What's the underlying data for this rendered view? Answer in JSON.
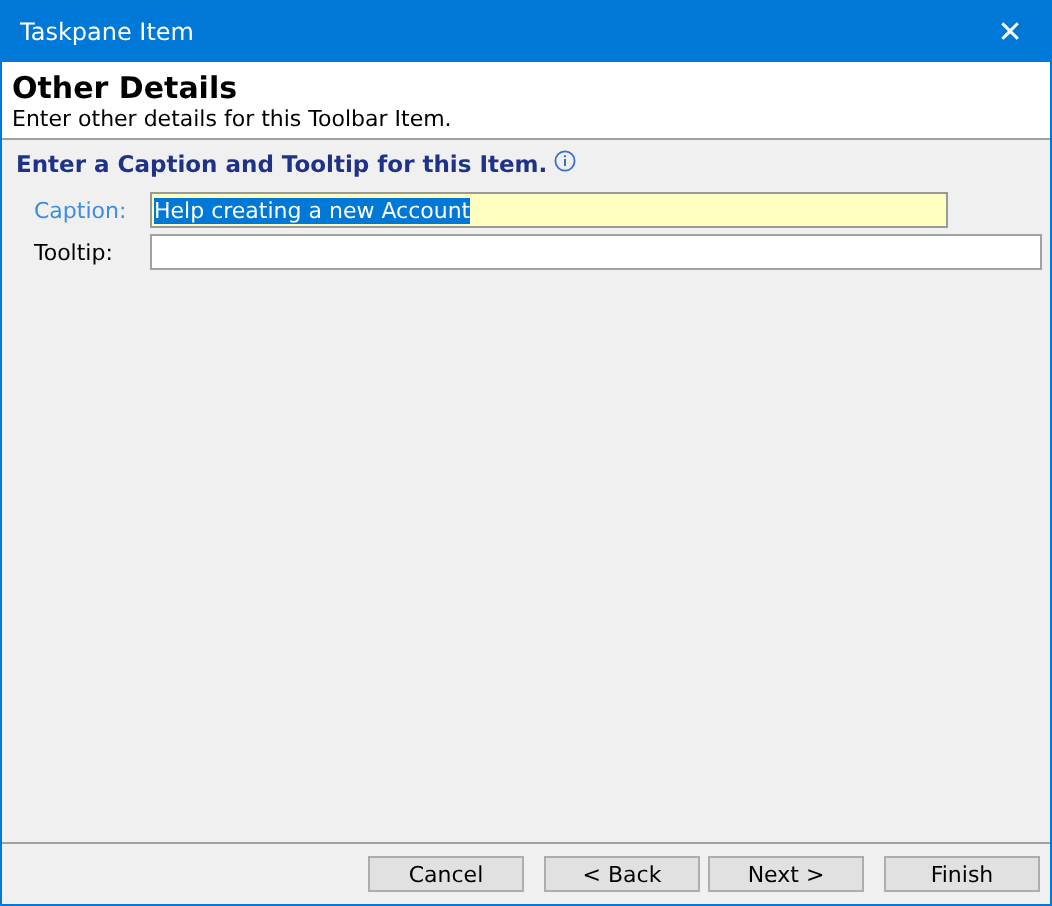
{
  "window": {
    "title": "Taskpane Item",
    "close": "✕"
  },
  "header": {
    "title": "Other Details",
    "subtitle": "Enter other details for this Toolbar Item."
  },
  "section": {
    "title": "Enter a Caption and Tooltip for this Item."
  },
  "fields": [
    {
      "label": "Caption:",
      "value": "Help creating a new Account",
      "focused": true
    },
    {
      "label": "Tooltip:",
      "focused": false
    }
  ],
  "buttons": [
    "Cancel",
    "< Back",
    "Next >",
    "Finish"
  ]
}
